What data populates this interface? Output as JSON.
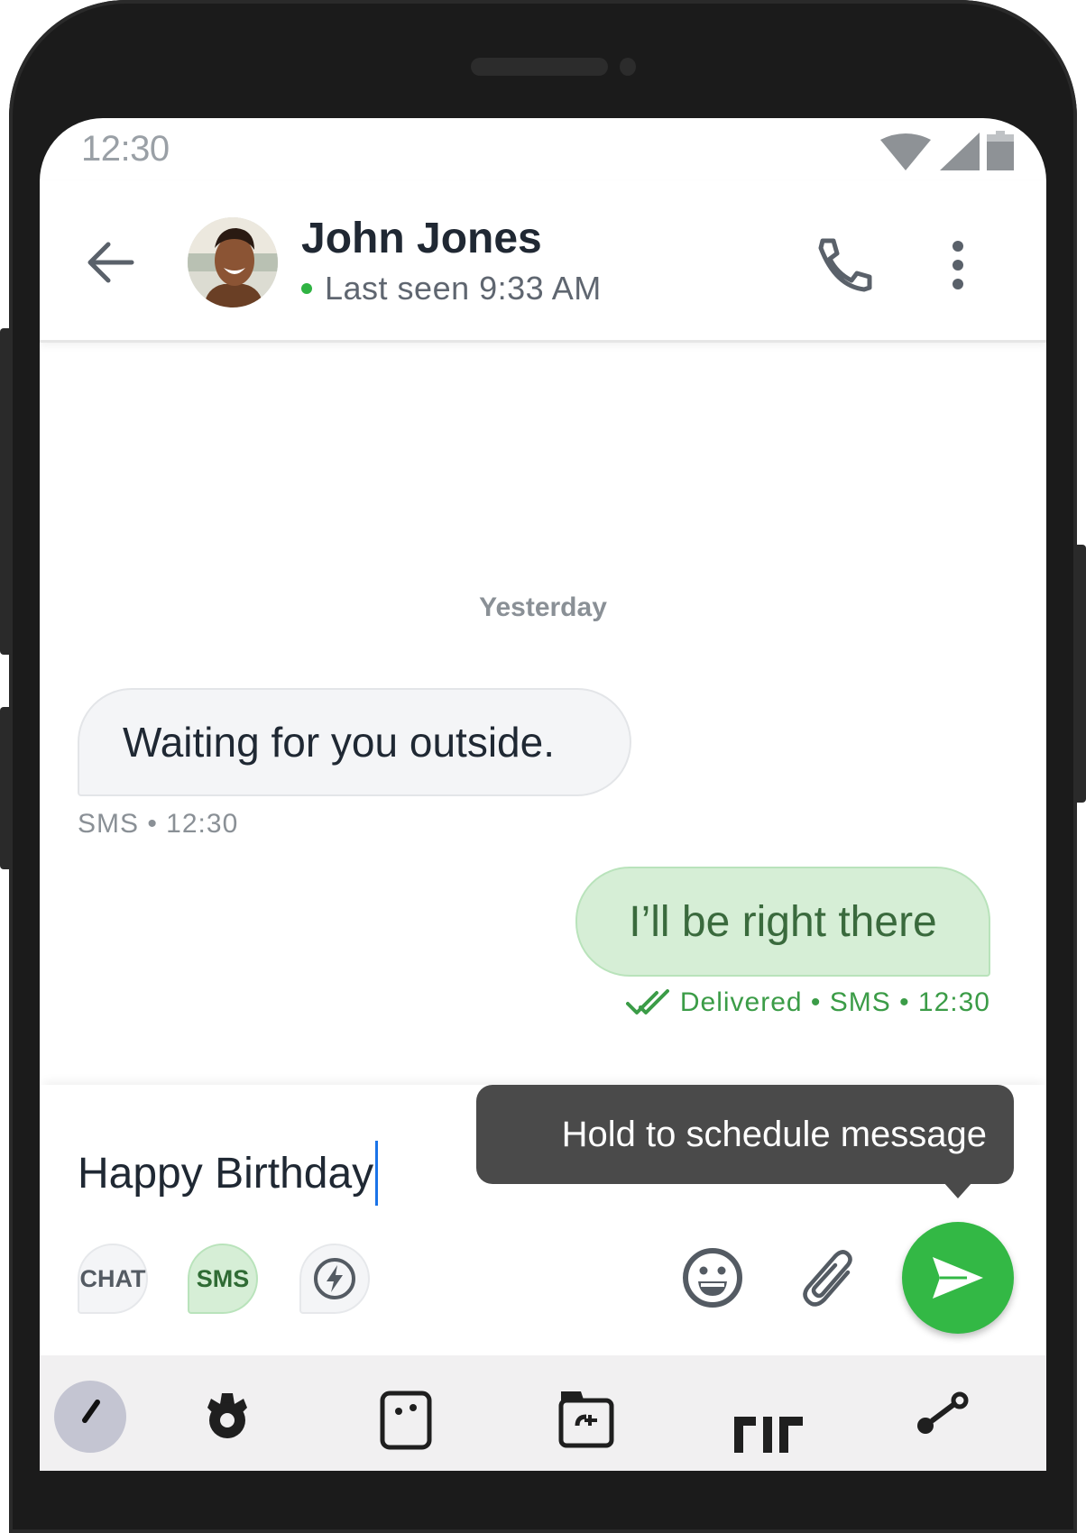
{
  "status_bar": {
    "time": "12:30",
    "icons": [
      "wifi-icon",
      "cellular-signal-icon",
      "battery-icon"
    ]
  },
  "header": {
    "back_icon": "arrow-left-icon",
    "contact_name": "John Jones",
    "presence_text": "Last seen 9:33 AM",
    "presence_color": "#2fb342",
    "call_icon": "phone-icon",
    "more_icon": "more-vertical-icon"
  },
  "conversation": {
    "date_separator": "Yesterday",
    "messages": [
      {
        "direction": "incoming",
        "text": "Waiting for you outside.",
        "meta": "SMS • 12:30"
      },
      {
        "direction": "outgoing",
        "text": "I’ll be right there",
        "meta": "Delivered • SMS • 12:30",
        "status_icon": "double-check-icon"
      }
    ]
  },
  "composer": {
    "input_value": "Happy Birthday",
    "tooltip": "Hold to schedule message",
    "mode_chips": [
      {
        "label": "CHAT",
        "selected": false
      },
      {
        "label": "SMS",
        "selected": true
      },
      {
        "icon": "lightning-icon",
        "selected": false
      }
    ],
    "emoji_icon": "emoji-icon",
    "attach_icon": "paperclip-icon",
    "send_icon": "send-icon",
    "send_color": "#33b845"
  },
  "keyboard_toolbar": {
    "items": [
      "chevron-back-icon",
      "settings-gear-icon",
      "sticker-icon",
      "translate-icon",
      "GIF",
      "share-icon"
    ]
  }
}
